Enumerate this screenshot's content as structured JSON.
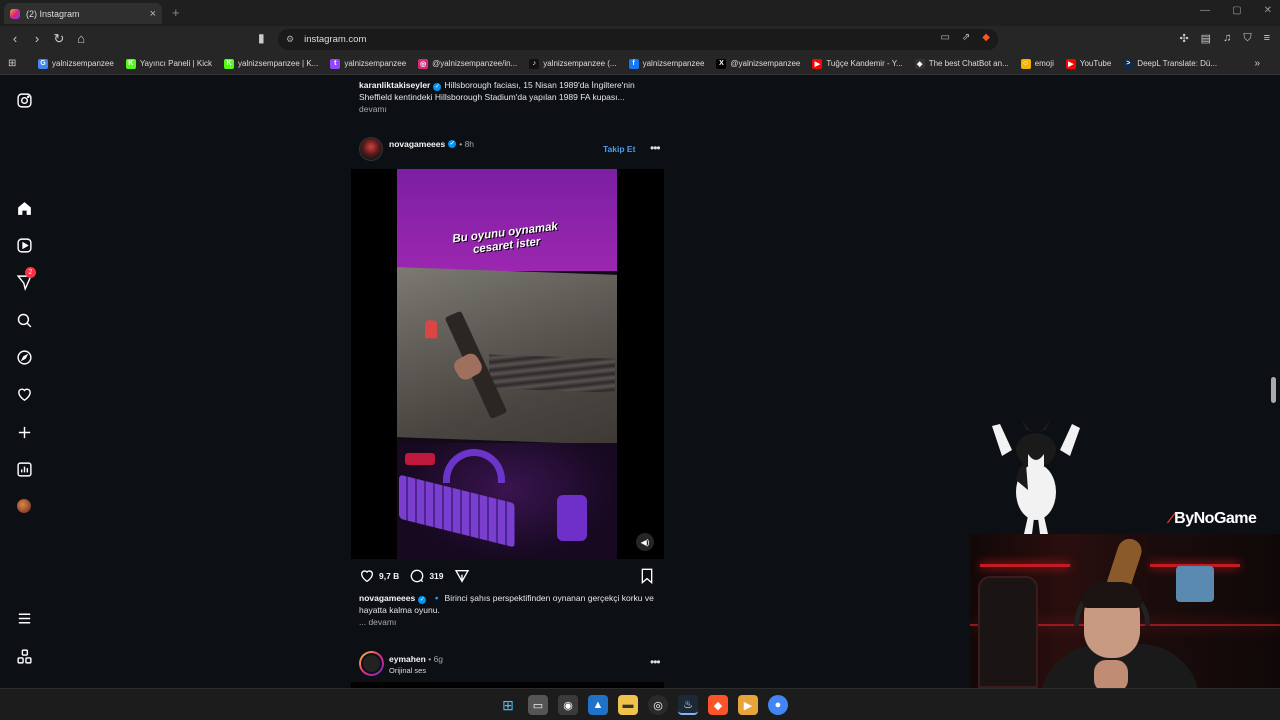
{
  "browser": {
    "tab_title": "(2) Instagram",
    "tab_close": "×",
    "new_tab": "+",
    "url": "instagram.com",
    "win_minimize": "—",
    "win_maximize": "▢",
    "win_close": "✕",
    "bookmarks": [
      {
        "label": "yalnizsempanzee",
        "icon": "google-icon",
        "color": "#4285f4",
        "glyph": "G"
      },
      {
        "label": "Yayıncı Paneli | Kick",
        "icon": "kick-icon",
        "color": "#53fc18",
        "glyph": "K"
      },
      {
        "label": "yalnizsempanzee | K...",
        "icon": "kick-icon",
        "color": "#53fc18",
        "glyph": "K"
      },
      {
        "label": "yalnizsempanzee",
        "icon": "twitch-icon",
        "color": "#9146ff",
        "glyph": "t"
      },
      {
        "label": "@yalnizsempanzee/in...",
        "icon": "instagram-icon",
        "color": "#d62976",
        "glyph": "◎"
      },
      {
        "label": "yalnizsempanzee (...",
        "icon": "tiktok-icon",
        "color": "#111111",
        "glyph": "♪"
      },
      {
        "label": "yalnizsempanzee",
        "icon": "facebook-icon",
        "color": "#1877f2",
        "glyph": "f"
      },
      {
        "label": "@yalnizsempanzee",
        "icon": "x-icon",
        "color": "#000000",
        "glyph": "X"
      },
      {
        "label": "Tuğçe Kandemir - Y...",
        "icon": "youtube-icon",
        "color": "#ff0000",
        "glyph": "▶"
      },
      {
        "label": "The best ChatBot an...",
        "icon": "chatbot-icon",
        "color": "#333333",
        "glyph": "◆"
      },
      {
        "label": "emoji",
        "icon": "emoji-icon",
        "color": "#f5b400",
        "glyph": "☺"
      },
      {
        "label": "YouTube",
        "icon": "youtube-icon",
        "color": "#ff0000",
        "glyph": "▶"
      },
      {
        "label": "DeepL Translate: Dü...",
        "icon": "deepl-icon",
        "color": "#0f2b46",
        "glyph": ">"
      }
    ],
    "bookmarks_more": "»"
  },
  "sidebar": {
    "notification_count": "2"
  },
  "feed": {
    "prev_post": {
      "username": "karanliktakiseyler",
      "caption": "Hillsborough faciası, 15 Nisan 1989'da İngiltere'nin Sheffield kentindeki Hillsborough Stadium'da yapılan 1989 FA kupası...",
      "more": "devamı"
    },
    "post": {
      "username": "novagameees",
      "time": "• 8h",
      "follow": "Takip Et",
      "options": "•••",
      "overlay_text_line1": "Bu oyunu oynamak",
      "overlay_text_line2": "cesaret ister",
      "likes": "9,7 B",
      "comments": "319",
      "caption_username": "novagameees",
      "caption": "🔹 Birinci şahıs perspektifinden oynanan gerçekçi korku ve hayatta kalma oyunu.",
      "more": "... devamı"
    },
    "next_post": {
      "username": "eymahen",
      "time": "• 6g",
      "audio": "Orijinal ses",
      "options": "•••"
    }
  },
  "overlay": {
    "brand": "ByNoGame"
  }
}
